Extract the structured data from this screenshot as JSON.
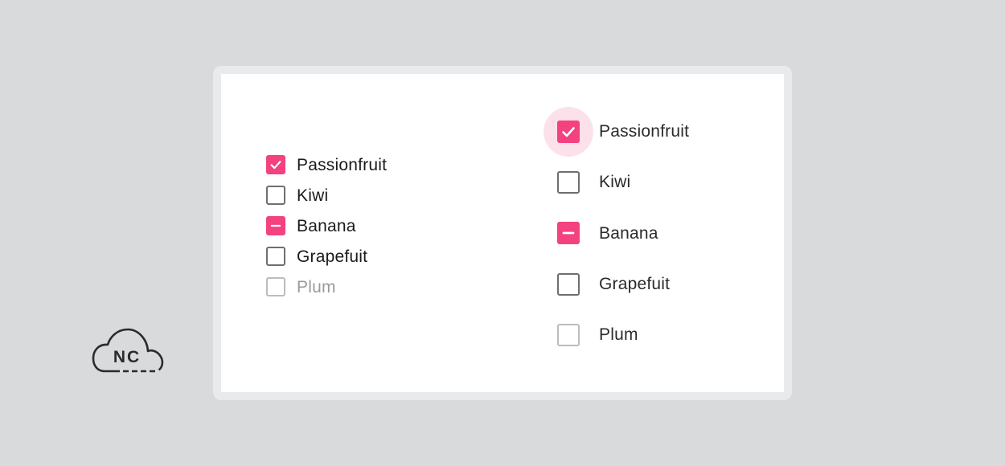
{
  "brand": {
    "logo_text": "NC",
    "logo_icon": "cloud-icon"
  },
  "colors": {
    "background": "#d9dadb",
    "card": "#ffffff",
    "accent": "#f4417f",
    "accent_halo": "#fde1ea",
    "unchecked_border": "#6f6f6f",
    "disabled_border": "#bcbcbc"
  },
  "lists": [
    {
      "variant": "dense",
      "items": [
        {
          "label": "Passionfruit",
          "state": "checked"
        },
        {
          "label": "Kiwi",
          "state": "unchecked"
        },
        {
          "label": "Banana",
          "state": "indeterminate"
        },
        {
          "label": "Grapefuit",
          "state": "unchecked"
        },
        {
          "label": "Plum",
          "state": "disabled"
        }
      ]
    },
    {
      "variant": "comfortable",
      "items": [
        {
          "label": "Passionfruit",
          "state": "checked",
          "focused": true
        },
        {
          "label": "Kiwi",
          "state": "unchecked"
        },
        {
          "label": "Banana",
          "state": "indeterminate"
        },
        {
          "label": "Grapefuit",
          "state": "unchecked"
        },
        {
          "label": "Plum",
          "state": "disabled"
        }
      ]
    }
  ]
}
